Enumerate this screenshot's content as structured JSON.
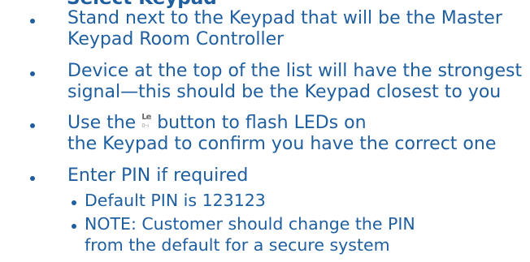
{
  "heading_partial": "Select Keypad",
  "bullets": [
    {
      "lines": [
        "Stand next to the Keypad that will be the Master",
        "Keypad Room Controller"
      ]
    },
    {
      "lines": [
        "Device at the top of the list will have the strongest",
        "signal—this should be the Keypad closest to you"
      ]
    },
    {
      "line1_before": "Use the",
      "line1_after": "button to flash LEDs on",
      "line2": "the Keypad to confirm you have the correct one",
      "icon": {
        "name": "flash-leds-icon",
        "top_glyph": "Le",
        "bottom_glyph": "0-ı"
      }
    },
    {
      "lines": [
        "Enter PIN if required"
      ]
    }
  ],
  "sub_bullets": [
    {
      "lines": [
        "Default PIN is 123123"
      ]
    },
    {
      "lines": [
        "NOTE: Customer should change the PIN",
        "from the default for a secure system"
      ]
    }
  ],
  "colors": {
    "text": "#1f5fa0",
    "icon": "#6b6b6b"
  }
}
